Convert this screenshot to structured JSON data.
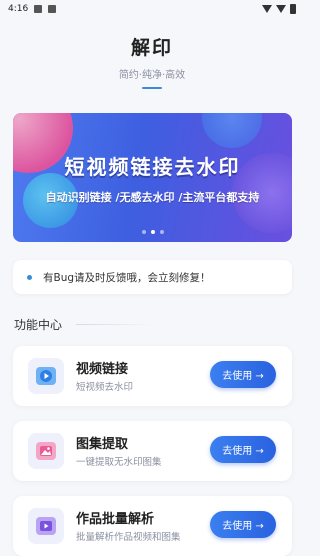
{
  "status_bar": {
    "time": "4:16"
  },
  "header": {
    "title": "解印",
    "subtitle": "简约·纯净·高效",
    "accent_color": "#3b8bd9"
  },
  "banner": {
    "title": "短视频链接去水印",
    "subtitle": "自动识别链接 /无感去水印 /主流平台都支持",
    "page_count": 3,
    "active_index": 1
  },
  "notice": {
    "text": "有Bug请及时反馈哦，会立刻修复！"
  },
  "section": {
    "title": "功能中心"
  },
  "features": [
    {
      "title": "视频链接",
      "desc": "短视频去水印",
      "button": "去使用 →",
      "icon": "play-icon"
    },
    {
      "title": "图集提取",
      "desc": "一键提取无水印图集",
      "button": "去使用 →",
      "icon": "image-icon"
    },
    {
      "title": "作品批量解析",
      "desc": "批量解析作品视频和图集",
      "button": "去使用 →",
      "icon": "batch-icon"
    }
  ]
}
